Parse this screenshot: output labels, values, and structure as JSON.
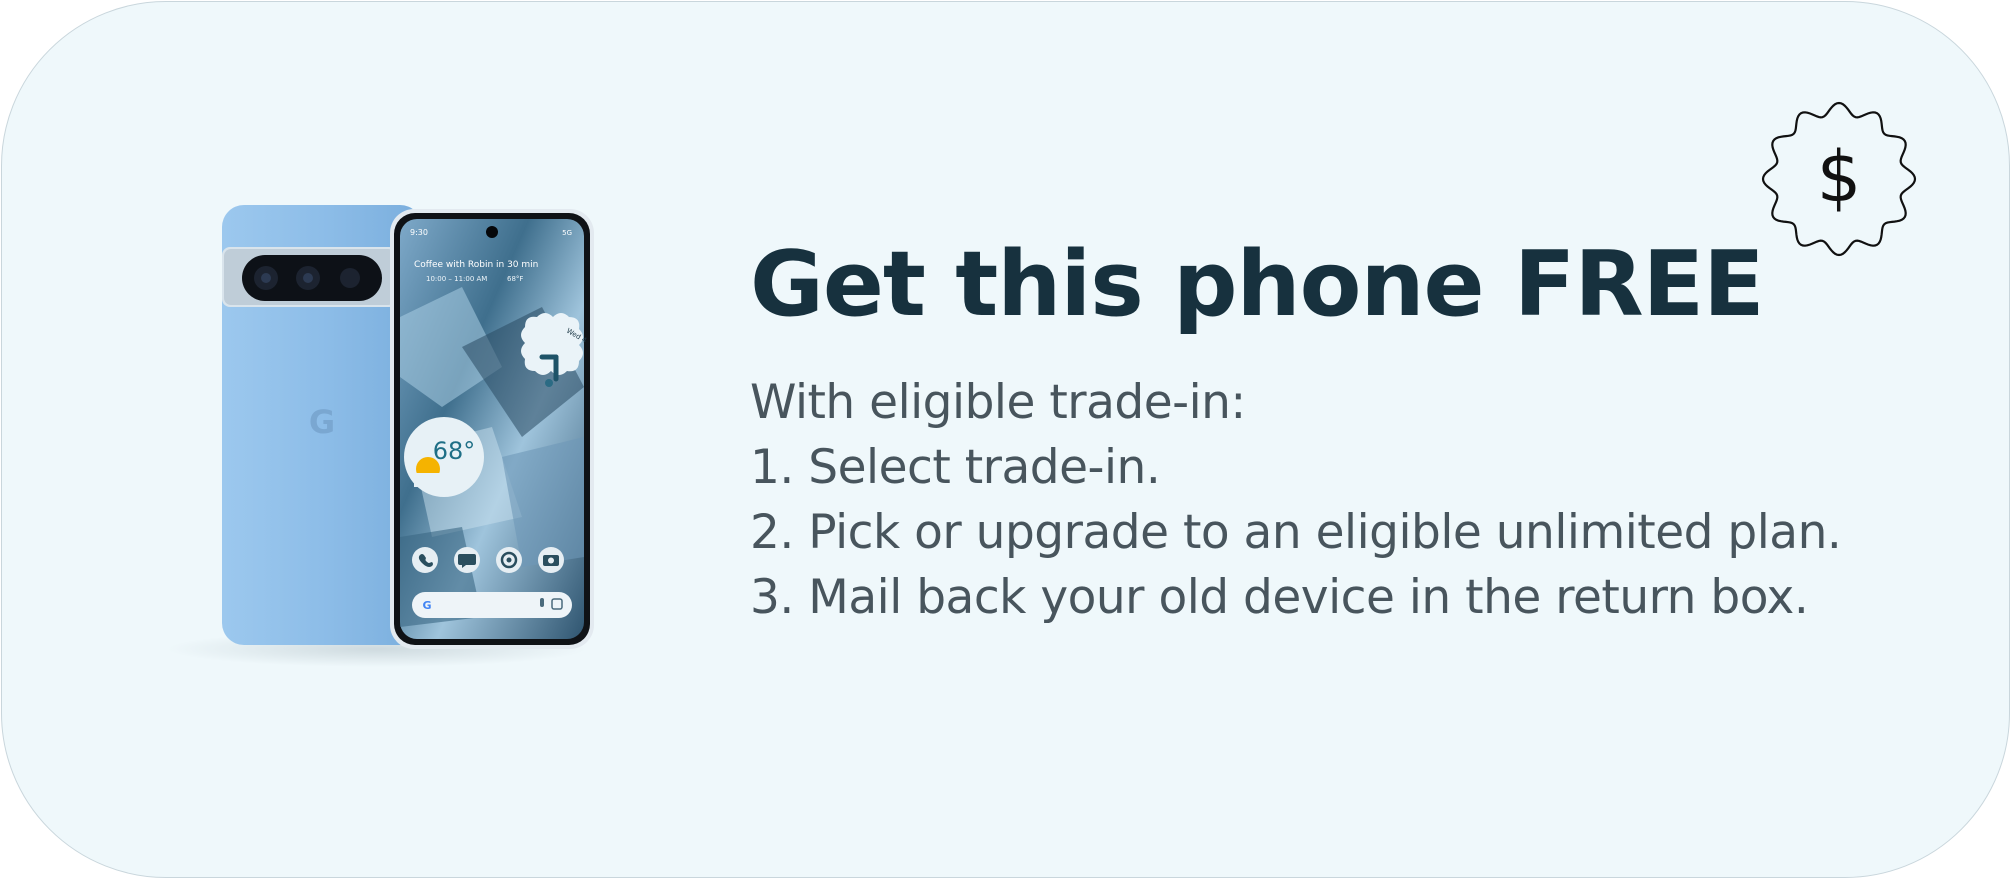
{
  "promo": {
    "headline": "Get this phone FREE",
    "intro": "With eligible trade-in:",
    "steps": [
      "1. Select trade-in.",
      "2. Pick or upgrade to an eligible unlimited plan.",
      "3. Mail back your old device in the return box."
    ],
    "badge_symbol": "$",
    "badge_icon": "price-tag-badge-icon"
  },
  "phone_screen": {
    "status_time": "9:30",
    "status_right": "5G",
    "event_line": "Coffee with Robin in 30 min",
    "event_time": "10:00 – 11:00 AM",
    "event_temp": "68°F",
    "weather_temp": "68°",
    "clock_date": "Wed 4",
    "search_logo": "G"
  },
  "colors": {
    "card_background": "#eff8fb",
    "headline": "#17313e",
    "body_text": "#48555d",
    "phone_blue": "#8dbde8"
  }
}
